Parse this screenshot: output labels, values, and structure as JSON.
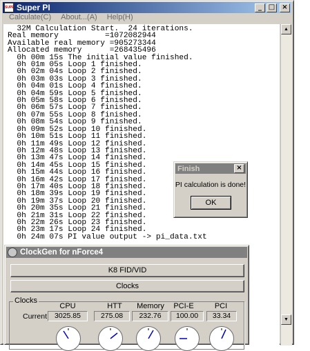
{
  "superpi": {
    "title": "Super PI",
    "icon_text": "SUPER",
    "menu": [
      "Calculate(C)",
      "About...(A)",
      "Help(H)"
    ],
    "caption_buttons": [
      "_",
      "□",
      "×"
    ],
    "console_text": "  32M Calculation Start.  24 iterations.\nReal memory          =1072082944\nAvailable real memory =905273344\nAllocated memory      =268435496\n  0h 00m 15s The initial value finished.\n  0h 01m 05s Loop 1 finished.\n  0h 02m 04s Loop 2 finished.\n  0h 03m 03s Loop 3 finished.\n  0h 04m 01s Loop 4 finished.\n  0h 04m 59s Loop 5 finished.\n  0h 05m 58s Loop 6 finished.\n  0h 06m 57s Loop 7 finished.\n  0h 07m 55s Loop 8 finished.\n  0h 08m 54s Loop 9 finished.\n  0h 09m 52s Loop 10 finished.\n  0h 10m 51s Loop 11 finished.\n  0h 11m 49s Loop 12 finished.\n  0h 12m 48s Loop 13 finished.\n  0h 13m 47s Loop 14 finished.\n  0h 14m 45s Loop 15 finished.\n  0h 15m 44s Loop 16 finished.\n  0h 16m 42s Loop 17 finished.\n  0h 17m 40s Loop 18 finished.\n  0h 18m 39s Loop 19 finished.\n  0h 19m 37s Loop 20 finished.\n  0h 20m 35s Loop 21 finished.\n  0h 21m 31s Loop 22 finished.\n  0h 22m 26s Loop 23 finished.\n  0h 23m 17s Loop 24 finished.\n  0h 24m 07s PI value output -> pi_data.txt",
    "scroll_up": "▲",
    "scroll_down": "▼"
  },
  "finish_dialog": {
    "title": "Finish",
    "close": "×",
    "message": "PI calculation is done!",
    "ok_label": "OK"
  },
  "clockgen": {
    "title": "ClockGen for nForce4",
    "tab_k8": "K8 FID/VID",
    "tab_clocks": "Clocks",
    "group_label": "Clocks",
    "row_label": "Current",
    "columns": [
      {
        "header": "CPU",
        "value": "3025.85"
      },
      {
        "header": "HTT",
        "value": "275.08"
      },
      {
        "header": "Memory",
        "value": "232.76"
      },
      {
        "header": "PCI-E",
        "value": "100.00"
      },
      {
        "header": "PCI",
        "value": "33.34"
      }
    ]
  },
  "colors": {
    "title_active": "#0a246a",
    "title_gradient_end": "#a6caf0",
    "title_inactive": "#808080",
    "face": "#d4d0c8",
    "gauge_needle": "#0000c0"
  }
}
